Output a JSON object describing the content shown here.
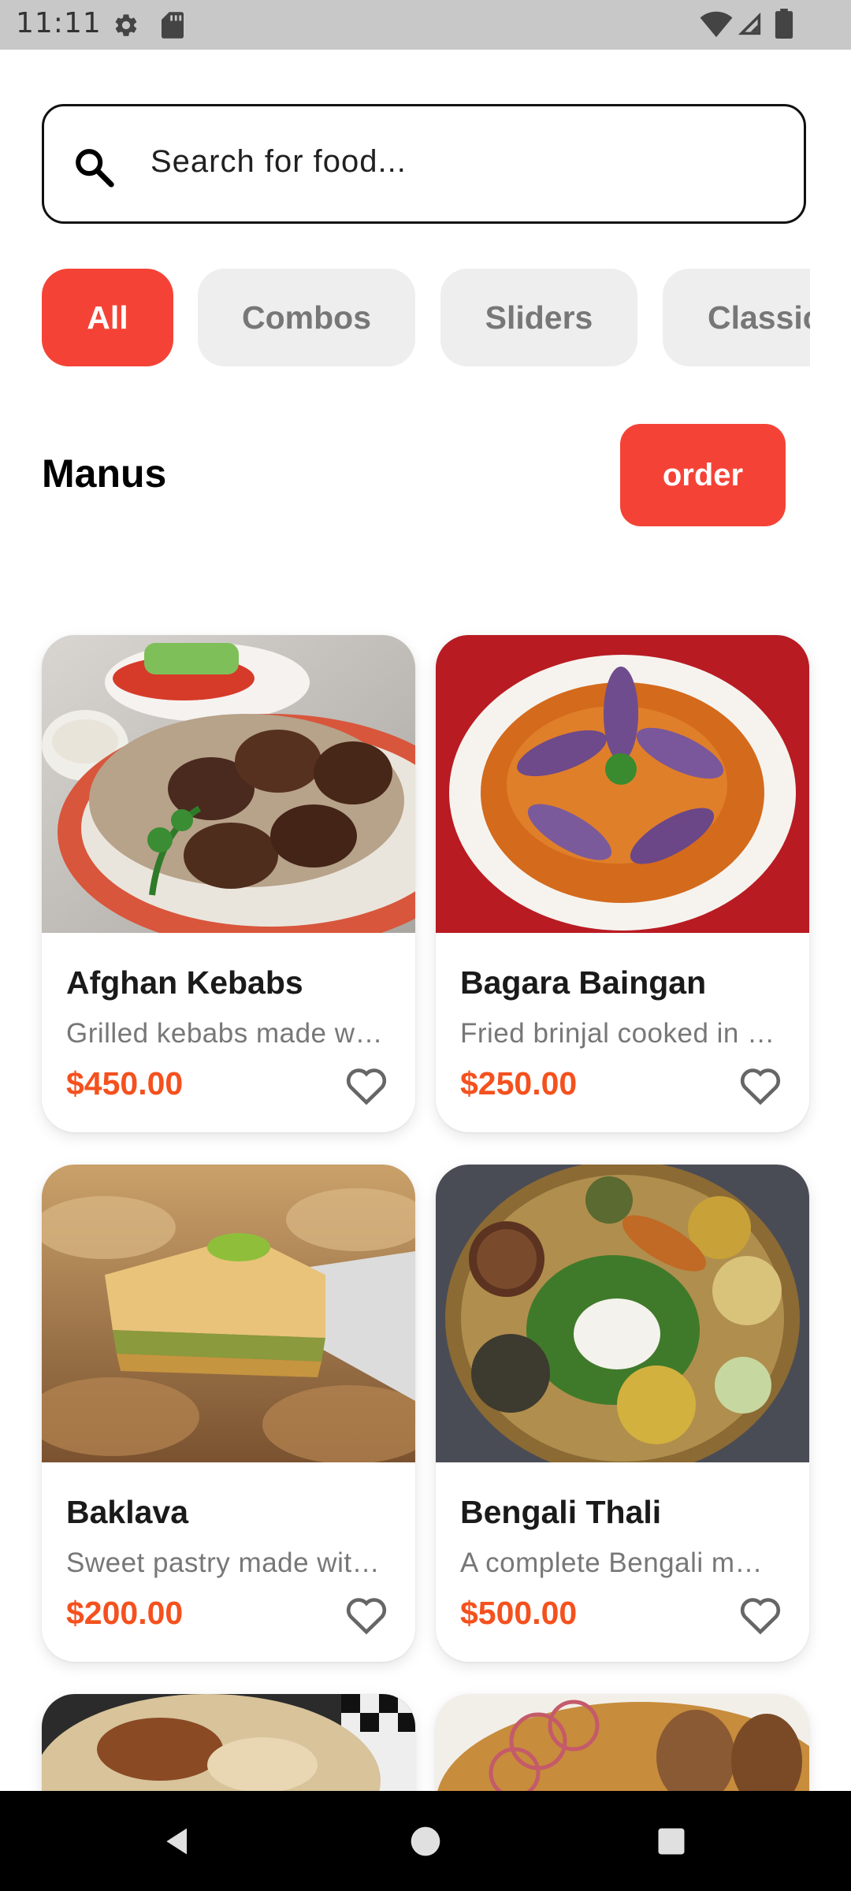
{
  "status_bar": {
    "time": "11:11",
    "icons": [
      "gear-icon",
      "sd-card-icon",
      "wifi-icon",
      "signal-icon",
      "battery-icon"
    ]
  },
  "search": {
    "placeholder": "Search for food..."
  },
  "categories": [
    {
      "label": "All",
      "active": true
    },
    {
      "label": "Combos",
      "active": false
    },
    {
      "label": "Sliders",
      "active": false
    },
    {
      "label": "Classic",
      "active": false
    }
  ],
  "section": {
    "title": "Manus",
    "order_label": "order"
  },
  "menu_items": [
    {
      "name": "Afghan Kebabs",
      "description": "Grilled kebabs made w…",
      "price": "$450.00"
    },
    {
      "name": "Bagara Baingan",
      "description": "Fried brinjal cooked in …",
      "price": "$250.00"
    },
    {
      "name": "Baklava",
      "description": "Sweet pastry made wit…",
      "price": "$200.00"
    },
    {
      "name": "Bengali Thali",
      "description": "A complete Bengali m…",
      "price": "$500.00"
    }
  ],
  "nav": {
    "icons": [
      "back-icon",
      "home-icon",
      "recents-icon"
    ]
  },
  "colors": {
    "accent": "#f44336",
    "price": "#f4511e",
    "chip_bg": "#eeeeee",
    "status_bar_bg": "#c8c8c8"
  }
}
